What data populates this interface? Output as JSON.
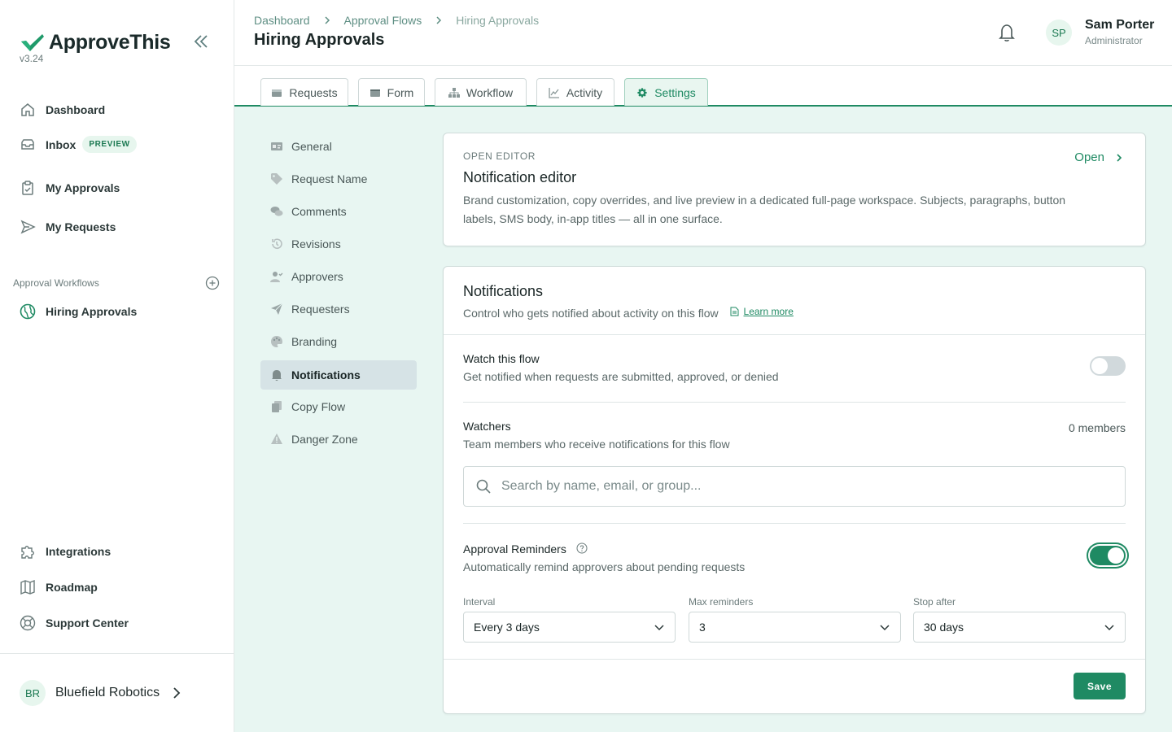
{
  "app": {
    "name": "ApproveThis",
    "version": "v3.24"
  },
  "sidebar": {
    "nav": [
      {
        "label": "Dashboard",
        "icon": "home-icon"
      },
      {
        "label": "Inbox",
        "badge": "PREVIEW",
        "icon": "inbox-icon"
      },
      {
        "label": "My Approvals",
        "icon": "clipboard-icon"
      },
      {
        "label": "My Requests",
        "icon": "send-icon"
      }
    ],
    "workflows_label": "Approval Workflows",
    "workflows": [
      {
        "label": "Hiring Approvals",
        "icon": "globe-icon"
      }
    ],
    "bottom": [
      {
        "label": "Integrations",
        "icon": "puzzle-icon"
      },
      {
        "label": "Roadmap",
        "icon": "map-icon"
      },
      {
        "label": "Support Center",
        "icon": "lifebuoy-icon"
      }
    ],
    "org": {
      "initials": "BR",
      "name": "Bluefield Robotics"
    }
  },
  "header": {
    "breadcrumbs": [
      "Dashboard",
      "Approval Flows",
      "Hiring Approvals"
    ],
    "title": "Hiring Approvals",
    "user": {
      "initials": "SP",
      "name": "Sam Porter",
      "role": "Administrator"
    }
  },
  "tabs": [
    {
      "label": "Requests",
      "icon": "tray-icon"
    },
    {
      "label": "Form",
      "icon": "form-icon"
    },
    {
      "label": "Workflow",
      "icon": "hierarchy-icon"
    },
    {
      "label": "Activity",
      "icon": "chart-line-icon"
    },
    {
      "label": "Settings",
      "icon": "gear-icon",
      "active": true
    }
  ],
  "settings_nav": [
    {
      "label": "General",
      "icon": "id-card-icon"
    },
    {
      "label": "Request Name",
      "icon": "tag-icon"
    },
    {
      "label": "Comments",
      "icon": "comments-icon"
    },
    {
      "label": "Revisions",
      "icon": "history-icon"
    },
    {
      "label": "Approvers",
      "icon": "user-check-icon"
    },
    {
      "label": "Requesters",
      "icon": "paper-plane-icon"
    },
    {
      "label": "Branding",
      "icon": "palette-icon"
    },
    {
      "label": "Notifications",
      "icon": "bell-icon",
      "active": true
    },
    {
      "label": "Copy Flow",
      "icon": "copy-icon"
    },
    {
      "label": "Danger Zone",
      "icon": "warning-icon"
    }
  ],
  "editor_card": {
    "eyebrow": "OPEN EDITOR",
    "title": "Notification editor",
    "description_1": "Brand customization, copy overrides, and live preview in a dedicated full-page workspace. Subjects, paragraphs, button",
    "description_2": "labels, SMS body, in-app titles — all in one surface.",
    "open_label": "Open"
  },
  "notifications": {
    "title": "Notifications",
    "subtitle": "Control who gets notified about activity on this flow",
    "learn_more": "Learn more",
    "watch": {
      "title": "Watch this flow",
      "subtitle": "Get notified when requests are submitted, approved, or denied",
      "enabled": false
    },
    "watchers": {
      "title": "Watchers",
      "subtitle": "Team members who receive notifications for this flow",
      "count": "0 members",
      "search_placeholder": "Search by name, email, or group..."
    },
    "reminders": {
      "title": "Approval Reminders",
      "subtitle": "Automatically remind approvers about pending requests",
      "enabled": true,
      "interval": {
        "label": "Interval",
        "value": "Every 3 days"
      },
      "max": {
        "label": "Max reminders",
        "value": "3"
      },
      "stop": {
        "label": "Stop after",
        "value": "30 days"
      }
    },
    "save_label": "Save"
  },
  "colors": {
    "accent": "#1f8a63",
    "background": "#e8f6f2"
  }
}
